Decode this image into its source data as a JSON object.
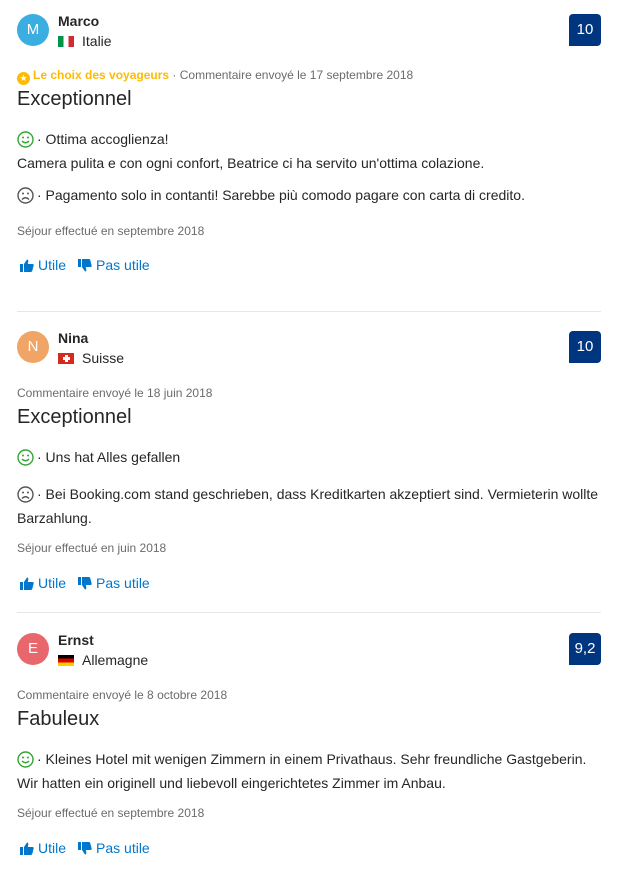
{
  "reviews": [
    {
      "avatar_letter": "M",
      "avatar_color": "#3aaee0",
      "name": "Marco",
      "country": "Italie",
      "score": "10",
      "choice_label": "Le choix des voyageurs",
      "meta": "· Commentaire envoyé le 17 septembre 2018",
      "title": "Exceptionnel",
      "positive": "· Ottima accoglienza!\nCamera pulita e con ogni confort, Beatrice ci ha servito un'ottima colazione.",
      "negative": "· Pagamento solo in contanti! Sarebbe più comodo pagare con carta di credito.",
      "stay": "Séjour effectué en septembre 2018",
      "helpful_label": "Utile",
      "not_helpful_label": "Pas utile"
    },
    {
      "avatar_letter": "N",
      "avatar_color": "#f0a465",
      "name": "Nina",
      "country": "Suisse",
      "score": "10",
      "meta": "Commentaire envoyé le 18 juin 2018",
      "title": "Exceptionnel",
      "positive": "· Uns hat Alles gefallen",
      "negative": "· Bei Booking.com stand geschrieben, dass Kreditkarten akzeptiert sind. Vermieterin wollte Barzahlung.",
      "stay": "Séjour effectué en juin 2018",
      "helpful_label": "Utile",
      "not_helpful_label": "Pas utile"
    },
    {
      "avatar_letter": "E",
      "avatar_color": "#e8676d",
      "name": "Ernst",
      "country": "Allemagne",
      "score": "9,2",
      "meta": "Commentaire envoyé le 8 octobre 2018",
      "title": "Fabuleux",
      "positive": "· Kleines Hotel mit wenigen Zimmern in einem Privathaus. Sehr freundliche Gastgeberin. Wir hatten ein originell und liebevoll eingerichtetes Zimmer im Anbau.",
      "stay": "Séjour effectué en septembre 2018",
      "helpful_label": "Utile",
      "not_helpful_label": "Pas utile"
    }
  ],
  "colors": {
    "score_bg": "#003580",
    "link": "#0077cc",
    "choice": "#febb02",
    "positive_icon": "#34a534",
    "negative_icon": "#555555"
  }
}
